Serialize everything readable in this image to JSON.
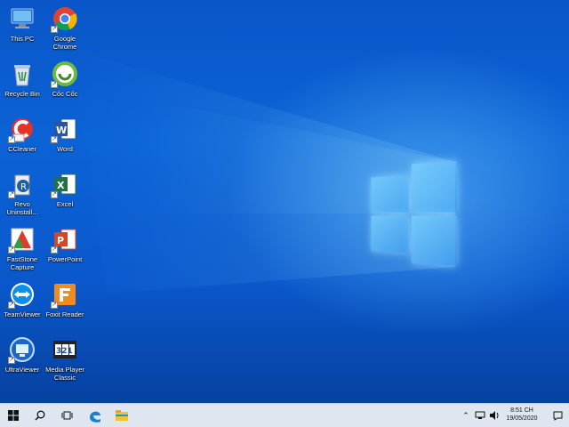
{
  "desktop": {
    "icons": [
      {
        "name": "this-pc",
        "label": "This PC"
      },
      {
        "name": "google-chrome",
        "label": "Google Chrome"
      },
      {
        "name": "recycle-bin",
        "label": "Recycle Bin"
      },
      {
        "name": "coc-coc",
        "label": "Cốc Cốc"
      },
      {
        "name": "ccleaner",
        "label": "CCleaner"
      },
      {
        "name": "word",
        "label": "Word"
      },
      {
        "name": "revo-uninstaller",
        "label": "Revo Uninstall..."
      },
      {
        "name": "excel",
        "label": "Excel"
      },
      {
        "name": "faststone-capture",
        "label": "FastStone Capture"
      },
      {
        "name": "powerpoint",
        "label": "PowerPoint"
      },
      {
        "name": "teamviewer",
        "label": "TeamViewer"
      },
      {
        "name": "foxit-reader",
        "label": "Foxit Reader"
      },
      {
        "name": "ultraviewer",
        "label": "UltraViewer"
      },
      {
        "name": "media-player-classic",
        "label": "Media Player Classic"
      }
    ]
  },
  "taskbar": {
    "buttons": [
      "windows-start-icon",
      "search-icon",
      "task-view-icon",
      "edge-icon",
      "file-explorer-icon"
    ],
    "tray_icons": [
      "chevron-up-icon",
      "network-icon",
      "volume-icon"
    ],
    "clock": {
      "time": "8:51 CH",
      "date": "19/05/2020"
    },
    "notification_icon": "action-center-icon"
  },
  "colors": {
    "desktop": "#0b63d6",
    "taskbar": "#dfe6ef",
    "edge": "#1a7fd4",
    "explorer": "#f2c230"
  }
}
